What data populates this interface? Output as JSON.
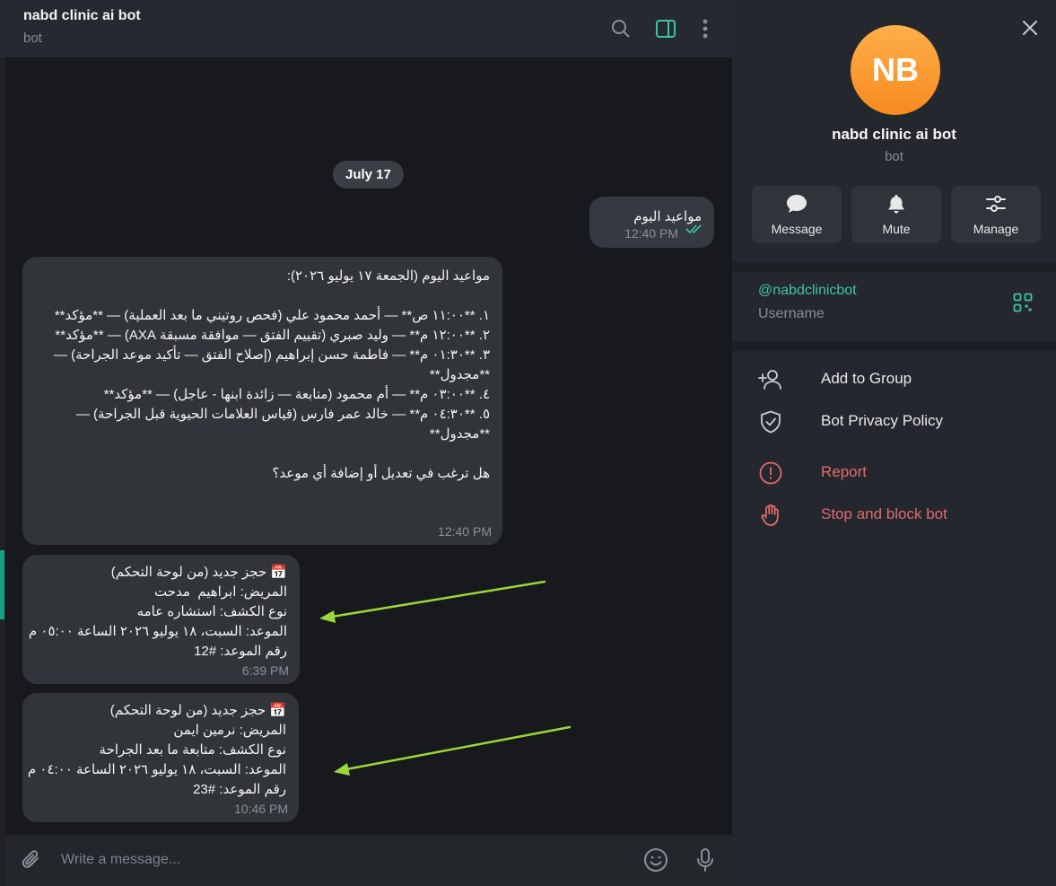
{
  "chat": {
    "title": "nabd clinic ai bot",
    "status": "bot",
    "date_chip": "July 17",
    "messages": [
      {
        "direction": "out",
        "text": "مواعيد اليوم",
        "time": "12:40 PM",
        "read": true
      },
      {
        "direction": "in",
        "text": "مواعيد اليوم (الجمعة ١٧ يوليو ٢٠٢٦):\n\n١. **١١:٠٠ ص** — أحمد محمود علي (فحص روتيني ما بعد العملية) — **مؤكد**\n٢. **١٢:٠٠ م** — وليد صبري (تقييم الفتق — موافقة مسبقة AXA) — **مؤكد**\n٣. **٠١:٣٠ م** — فاطمة حسن إبراهيم (إصلاح الفتق — تأكيد موعد الجراحة) — **مجدول**\n٤. **٠٣:٠٠ م** — أم محمود (متابعة — زائدة ابنها - عاجل) — **مؤكد**\n٥. **٠٤:٣٠ م** — خالد عمر فارس (قياس العلامات الحيوية قبل الجراحة) — **مجدول**\n\nهل ترغب في تعديل أو إضافة أي موعد؟",
        "time": "12:40 PM"
      },
      {
        "direction": "in",
        "text": "📅 حجز جديد (من لوحة التحكم)\nالمريض: ابراهيم  مدحت\nنوع الكشف: استشاره عامه\nالموعد: السبت، ١٨ يوليو ٢٠٢٦ الساعة ٠٥:٠٠ م\nرقم الموعد: #12",
        "time": "6:39 PM"
      },
      {
        "direction": "in",
        "text": "📅 حجز جديد (من لوحة التحكم)\nالمريض: نرمين ايمن\nنوع الكشف: متابعة ما بعد الجراحة\nالموعد: السبت، ١٨ يوليو ٢٠٢٦ الساعة ٠٤:٠٠ م\nرقم الموعد: #23",
        "time": "10:46 PM"
      }
    ],
    "composer": {
      "placeholder": "Write a message..."
    }
  },
  "icons": {
    "header": [
      "search-icon",
      "sidebar-toggle-icon",
      "more-vertical-icon"
    ],
    "composer": [
      "paperclip-icon",
      "emoji-icon",
      "microphone-icon"
    ]
  },
  "colors": {
    "accent": "#3fc3a8",
    "danger": "#e06a6a",
    "arrow": "#9bd63a",
    "avatar": "#f68a1f"
  },
  "panel": {
    "avatar_initials": "NB",
    "name": "nabd clinic ai bot",
    "subtitle": "bot",
    "actions": [
      {
        "label": "Message",
        "icon": "chat-bubble-icon"
      },
      {
        "label": "Mute",
        "icon": "bell-icon"
      },
      {
        "label": "Manage",
        "icon": "sliders-icon"
      }
    ],
    "username": "@nabdclinicbot",
    "username_label": "Username",
    "menu": [
      {
        "label": "Add to Group",
        "icon": "add-user-icon",
        "danger": false
      },
      {
        "label": "Bot Privacy Policy",
        "icon": "shield-check-icon",
        "danger": false
      },
      {
        "label": "Report",
        "icon": "alert-circle-icon",
        "danger": true
      },
      {
        "label": "Stop and block bot",
        "icon": "hand-stop-icon",
        "danger": true
      }
    ]
  }
}
